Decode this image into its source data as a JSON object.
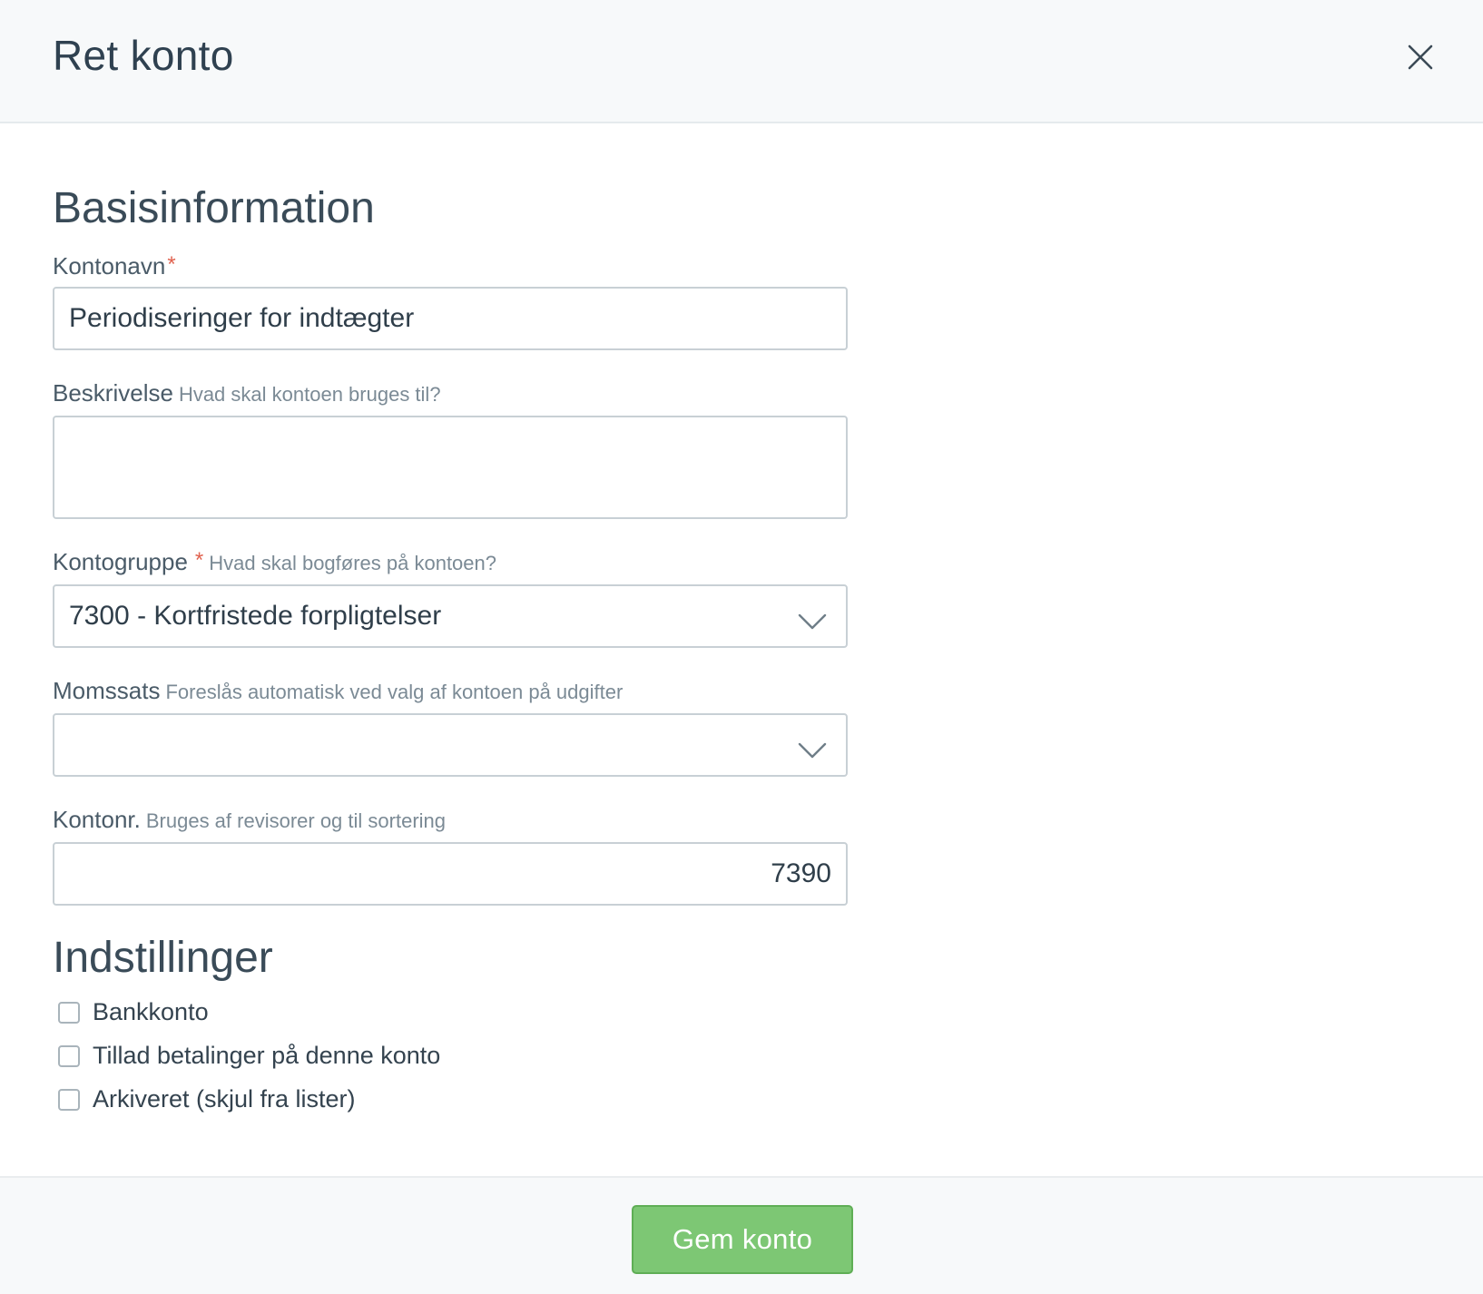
{
  "header": {
    "title": "Ret konto",
    "close_icon": "close-icon"
  },
  "basis": {
    "section_title": "Basisinformation",
    "account_name": {
      "label": "Kontonavn",
      "required_mark": "*",
      "value": "Periodiseringer for indtægter"
    },
    "description": {
      "label": "Beskrivelse",
      "help": "Hvad skal kontoen bruges til?",
      "value": ""
    },
    "account_group": {
      "label": "Kontogruppe",
      "required_mark": "*",
      "help": "Hvad skal bogføres på kontoen?",
      "selected": "7300 - Kortfristede forpligtelser"
    },
    "vat_rate": {
      "label": "Momssats",
      "help": "Foreslås automatisk ved valg af kontoen på udgifter",
      "selected": ""
    },
    "account_number": {
      "label": "Kontonr.",
      "help": "Bruges af revisorer og til sortering",
      "value": "7390"
    }
  },
  "settings": {
    "section_title": "Indstillinger",
    "options": [
      {
        "label": "Bankkonto",
        "checked": false
      },
      {
        "label": "Tillad betalinger på denne konto",
        "checked": false
      },
      {
        "label": "Arkiveret (skjul fra lister)",
        "checked": false
      }
    ]
  },
  "footer": {
    "save_label": "Gem konto"
  },
  "colors": {
    "accent_green": "#7dc774",
    "required_red": "#e0624f",
    "header_bg": "#f7f9fa"
  }
}
